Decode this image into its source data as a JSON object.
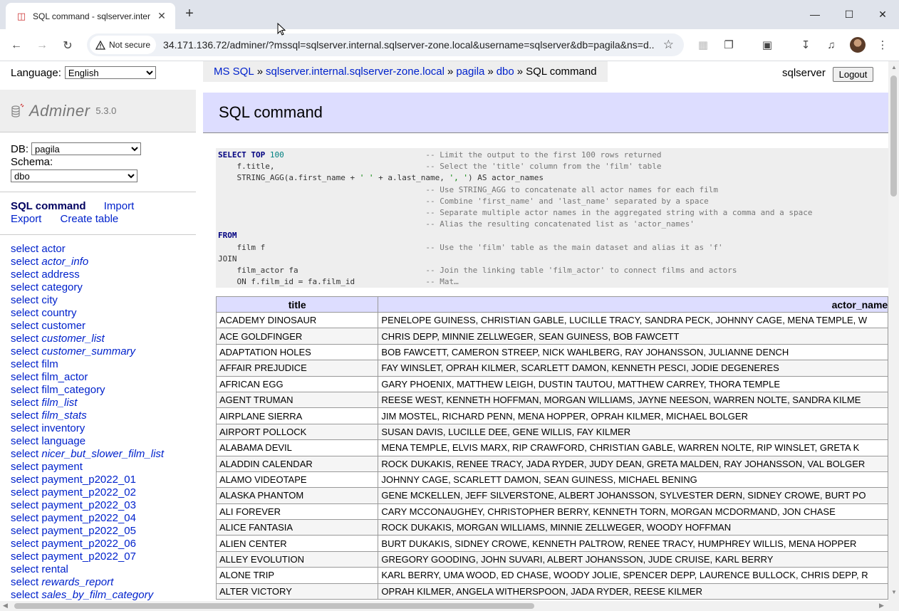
{
  "browser": {
    "tab_title": "SQL command - sqlserver.inter",
    "new_tab": "+",
    "secure_label": "Not secure",
    "url": "34.171.136.72/adminer/?mssql=sqlserver.internal.sqlserver-zone.local&username=sqlserver&db=pagila&ns=d..."
  },
  "menu": {
    "language_label": "Language:",
    "language_value": "English",
    "logo_name": "Adminer",
    "logo_version": "5.3.0",
    "db_label": "DB:",
    "db_value": "pagila",
    "schema_label": "Schema:",
    "schema_value": "dbo",
    "links": {
      "sql_command": "SQL command",
      "import": "Import",
      "export": "Export",
      "create_table": "Create table"
    },
    "tables": [
      {
        "prefix": "select",
        "name": "actor",
        "view": false
      },
      {
        "prefix": "select",
        "name": "actor_info",
        "view": true
      },
      {
        "prefix": "select",
        "name": "address",
        "view": false
      },
      {
        "prefix": "select",
        "name": "category",
        "view": false
      },
      {
        "prefix": "select",
        "name": "city",
        "view": false
      },
      {
        "prefix": "select",
        "name": "country",
        "view": false
      },
      {
        "prefix": "select",
        "name": "customer",
        "view": false
      },
      {
        "prefix": "select",
        "name": "customer_list",
        "view": true
      },
      {
        "prefix": "select",
        "name": "customer_summary",
        "view": true
      },
      {
        "prefix": "select",
        "name": "film",
        "view": false
      },
      {
        "prefix": "select",
        "name": "film_actor",
        "view": false
      },
      {
        "prefix": "select",
        "name": "film_category",
        "view": false
      },
      {
        "prefix": "select",
        "name": "film_list",
        "view": true
      },
      {
        "prefix": "select",
        "name": "film_stats",
        "view": true
      },
      {
        "prefix": "select",
        "name": "inventory",
        "view": false
      },
      {
        "prefix": "select",
        "name": "language",
        "view": false
      },
      {
        "prefix": "select",
        "name": "nicer_but_slower_film_list",
        "view": true
      },
      {
        "prefix": "select",
        "name": "payment",
        "view": false
      },
      {
        "prefix": "select",
        "name": "payment_p2022_01",
        "view": false
      },
      {
        "prefix": "select",
        "name": "payment_p2022_02",
        "view": false
      },
      {
        "prefix": "select",
        "name": "payment_p2022_03",
        "view": false
      },
      {
        "prefix": "select",
        "name": "payment_p2022_04",
        "view": false
      },
      {
        "prefix": "select",
        "name": "payment_p2022_05",
        "view": false
      },
      {
        "prefix": "select",
        "name": "payment_p2022_06",
        "view": false
      },
      {
        "prefix": "select",
        "name": "payment_p2022_07",
        "view": false
      },
      {
        "prefix": "select",
        "name": "rental",
        "view": false
      },
      {
        "prefix": "select",
        "name": "rewards_report",
        "view": true
      },
      {
        "prefix": "select",
        "name": "sales_by_film_category",
        "view": true
      }
    ]
  },
  "breadcrumb": [
    "MS SQL",
    "sqlserver.internal.sqlserver-zone.local",
    "pagila",
    "dbo"
  ],
  "breadcrumb_current": "SQL command",
  "breadcrumb_sep": "»",
  "user": {
    "name": "sqlserver",
    "logout": "Logout"
  },
  "heading": "SQL command",
  "sql_lines": [
    [
      [
        "kw",
        "SELECT TOP "
      ],
      [
        "num",
        "100"
      ],
      [
        "sp",
        "                              "
      ],
      [
        "cm",
        "-- Limit the output to the first 100 rows returned"
      ]
    ],
    [
      [
        "sp",
        "    "
      ],
      [
        "tx",
        "f.title,"
      ],
      [
        "sp",
        "                                "
      ],
      [
        "cm",
        "-- Select the 'title' column from the 'film' table"
      ]
    ],
    [
      [
        "sp",
        "    "
      ],
      [
        "tx",
        "STRING_AGG(a.first_name + "
      ],
      [
        "str",
        "' '"
      ],
      [
        "tx",
        " + a.last_name, "
      ],
      [
        "str",
        "', '"
      ],
      [
        "tx",
        ") AS actor_names"
      ]
    ],
    [
      [
        "sp",
        "                                            "
      ],
      [
        "cm",
        "-- Use STRING_AGG to concatenate all actor names for each film"
      ]
    ],
    [
      [
        "sp",
        "                                            "
      ],
      [
        "cm",
        "-- Combine 'first_name' and 'last_name' separated by a space"
      ]
    ],
    [
      [
        "sp",
        "                                            "
      ],
      [
        "cm",
        "-- Separate multiple actor names in the aggregated string with a comma and a space"
      ]
    ],
    [
      [
        "sp",
        "                                            "
      ],
      [
        "cm",
        "-- Alias the resulting concatenated list as 'actor_names'"
      ]
    ],
    [
      [
        "kw",
        "FROM"
      ]
    ],
    [
      [
        "sp",
        "    "
      ],
      [
        "tx",
        "film f"
      ],
      [
        "sp",
        "                                  "
      ],
      [
        "cm",
        "-- Use the 'film' table as the main dataset and alias it as 'f'"
      ]
    ],
    [
      [
        "tx",
        "JOIN"
      ]
    ],
    [
      [
        "sp",
        "    "
      ],
      [
        "tx",
        "film_actor fa"
      ],
      [
        "sp",
        "                           "
      ],
      [
        "cm",
        "-- Join the linking table 'film_actor' to connect films and actors"
      ]
    ],
    [
      [
        "sp",
        "    "
      ],
      [
        "tx",
        "ON f.film_id = fa.film_id"
      ],
      [
        "sp",
        "               "
      ],
      [
        "cm",
        "-- Mat…"
      ]
    ]
  ],
  "results": {
    "columns": [
      "title",
      "actor_names"
    ],
    "rows": [
      [
        "ACADEMY DINOSAUR",
        "PENELOPE GUINESS, CHRISTIAN GABLE, LUCILLE TRACY, SANDRA PECK, JOHNNY CAGE, MENA TEMPLE, W"
      ],
      [
        "ACE GOLDFINGER",
        "CHRIS DEPP, MINNIE ZELLWEGER, SEAN GUINESS, BOB FAWCETT"
      ],
      [
        "ADAPTATION HOLES",
        "BOB FAWCETT, CAMERON STREEP, NICK WAHLBERG, RAY JOHANSSON, JULIANNE DENCH"
      ],
      [
        "AFFAIR PREJUDICE",
        "FAY WINSLET, OPRAH KILMER, SCARLETT DAMON, KENNETH PESCI, JODIE DEGENERES"
      ],
      [
        "AFRICAN EGG",
        "GARY PHOENIX, MATTHEW LEIGH, DUSTIN TAUTOU, MATTHEW CARREY, THORA TEMPLE"
      ],
      [
        "AGENT TRUMAN",
        "REESE WEST, KENNETH HOFFMAN, MORGAN WILLIAMS, JAYNE NEESON, WARREN NOLTE, SANDRA KILME"
      ],
      [
        "AIRPLANE SIERRA",
        "JIM MOSTEL, RICHARD PENN, MENA HOPPER, OPRAH KILMER, MICHAEL BOLGER"
      ],
      [
        "AIRPORT POLLOCK",
        "SUSAN DAVIS, LUCILLE DEE, GENE WILLIS, FAY KILMER"
      ],
      [
        "ALABAMA DEVIL",
        "MENA TEMPLE, ELVIS MARX, RIP CRAWFORD, CHRISTIAN GABLE, WARREN NOLTE, RIP WINSLET, GRETA K"
      ],
      [
        "ALADDIN CALENDAR",
        "ROCK DUKAKIS, RENEE TRACY, JADA RYDER, JUDY DEAN, GRETA MALDEN, RAY JOHANSSON, VAL BOLGER"
      ],
      [
        "ALAMO VIDEOTAPE",
        "JOHNNY CAGE, SCARLETT DAMON, SEAN GUINESS, MICHAEL BENING"
      ],
      [
        "ALASKA PHANTOM",
        "GENE MCKELLEN, JEFF SILVERSTONE, ALBERT JOHANSSON, SYLVESTER DERN, SIDNEY CROWE, BURT PO"
      ],
      [
        "ALI FOREVER",
        "CARY MCCONAUGHEY, CHRISTOPHER BERRY, KENNETH TORN, MORGAN MCDORMAND, JON CHASE"
      ],
      [
        "ALICE FANTASIA",
        "ROCK DUKAKIS, MORGAN WILLIAMS, MINNIE ZELLWEGER, WOODY HOFFMAN"
      ],
      [
        "ALIEN CENTER",
        "BURT DUKAKIS, SIDNEY CROWE, KENNETH PALTROW, RENEE TRACY, HUMPHREY WILLIS, MENA HOPPER"
      ],
      [
        "ALLEY EVOLUTION",
        "GREGORY GOODING, JOHN SUVARI, ALBERT JOHANSSON, JUDE CRUISE, KARL BERRY"
      ],
      [
        "ALONE TRIP",
        "KARL BERRY, UMA WOOD, ED CHASE, WOODY JOLIE, SPENCER DEPP, LAURENCE BULLOCK, CHRIS DEPP, R"
      ],
      [
        "ALTER VICTORY",
        "OPRAH KILMER, ANGELA WITHERSPOON, JADA RYDER, REESE KILMER"
      ]
    ]
  }
}
